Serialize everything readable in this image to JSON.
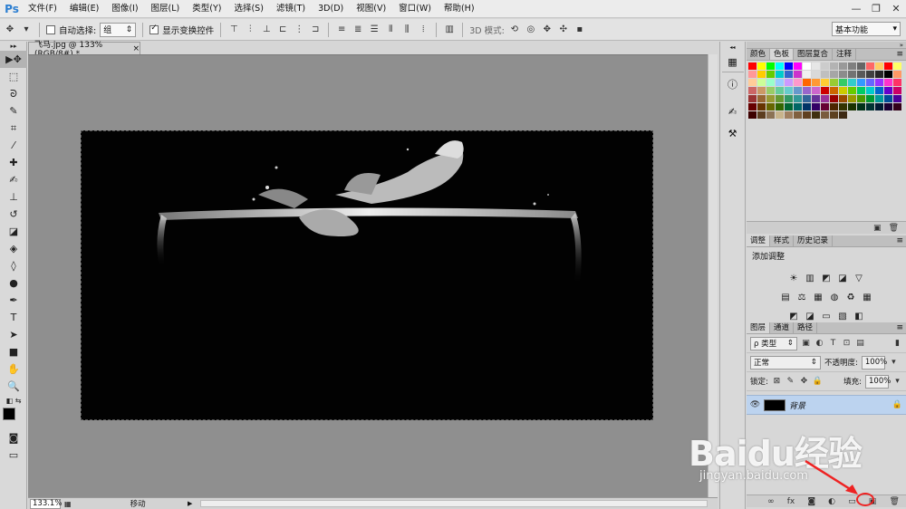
{
  "app": {
    "logo": "Ps"
  },
  "menu": [
    "文件(F)",
    "编辑(E)",
    "图像(I)",
    "图层(L)",
    "类型(Y)",
    "选择(S)",
    "滤镜(T)",
    "3D(D)",
    "视图(V)",
    "窗口(W)",
    "帮助(H)"
  ],
  "window_controls": {
    "minimize": "—",
    "restore": "❐",
    "close": "✕"
  },
  "options": {
    "auto_select_label": "自动选择:",
    "auto_select_value": "组",
    "show_transform_label": "显示变换控件",
    "mode_3d_label": "3D 模式:",
    "workspace": "基本功能"
  },
  "document": {
    "tab_title": "飞马.jpg @ 133%(RGB/8#) *",
    "close": "×"
  },
  "status": {
    "zoom": "133.1%",
    "info": "移动"
  },
  "swatches": {
    "tabs": [
      "颜色",
      "色板",
      "图层复合",
      "注释"
    ],
    "colors": [
      "#ff0000",
      "#ffff00",
      "#00ff00",
      "#00ffff",
      "#0000ff",
      "#ff00ff",
      "#ffffff",
      "#e6e6e6",
      "#cccccc",
      "#b3b3b3",
      "#999999",
      "#808080",
      "#666666",
      "#ff6666",
      "#ffcc66",
      "#ff0000",
      "#ffff66",
      "#ff9999",
      "#ffcc00",
      "#66cc00",
      "#00cccc",
      "#3366cc",
      "#cc33cc",
      "#f0f0f0",
      "#d9d9d9",
      "#bfbfbf",
      "#a6a6a6",
      "#8c8c8c",
      "#737373",
      "#595959",
      "#404040",
      "#262626",
      "#000000",
      "#ff9966",
      "#ffcc99",
      "#ccff99",
      "#99ffcc",
      "#99ccff",
      "#cc99ff",
      "#ff99cc",
      "#ff6600",
      "#ff9933",
      "#ffcc33",
      "#99cc33",
      "#33cc66",
      "#33cccc",
      "#3399ff",
      "#6666ff",
      "#9933ff",
      "#ff33cc",
      "#ff3366",
      "#cc6666",
      "#cc9966",
      "#99cc66",
      "#66cc99",
      "#66cccc",
      "#6699cc",
      "#9966cc",
      "#cc66cc",
      "#cc0000",
      "#cc6600",
      "#cccc00",
      "#66cc00",
      "#00cc66",
      "#00cccc",
      "#0066cc",
      "#6600cc",
      "#cc0066",
      "#993333",
      "#996633",
      "#999933",
      "#669933",
      "#339966",
      "#339999",
      "#336699",
      "#663399",
      "#993399",
      "#990000",
      "#994c00",
      "#999900",
      "#4c9900",
      "#009933",
      "#009999",
      "#004c99",
      "#4c0099",
      "#660000",
      "#663300",
      "#666600",
      "#336600",
      "#006633",
      "#006666",
      "#003366",
      "#330066",
      "#660033",
      "#4d2600",
      "#333300",
      "#1a3300",
      "#003319",
      "#003333",
      "#001a33",
      "#1a0033",
      "#33001a",
      "#3d0000",
      "#5c3d1f",
      "#8c7355",
      "#c8b48c",
      "#a08060",
      "#806040",
      "#604020",
      "#403010",
      "#7a5c3d",
      "#5c4020",
      "#3d2a14"
    ]
  },
  "adjustments": {
    "tabs": [
      "调整",
      "样式",
      "历史记录"
    ],
    "heading": "添加调整",
    "row1": [
      "☀",
      "▥",
      "◩",
      "◪",
      "▽"
    ],
    "row2": [
      "▤",
      "⚖",
      "▦",
      "◍",
      "♻",
      "▦"
    ],
    "row3": [
      "◩",
      "◪",
      "▭",
      "▧",
      "◧"
    ]
  },
  "layers": {
    "tabs": [
      "图层",
      "通道",
      "路径"
    ],
    "filter_label": "ρ 类型",
    "blend_mode": "正常",
    "opacity_label": "不透明度:",
    "opacity_value": "100%",
    "lock_label": "锁定:",
    "fill_label": "填充:",
    "fill_value": "100%",
    "layer_name": "背景",
    "footer_icons": [
      "∞",
      "fx",
      "◙",
      "◐",
      "▭",
      "▣",
      "🗑"
    ]
  },
  "watermark": {
    "main": "Baidu经验",
    "sub": "jingyan.baidu.com"
  },
  "accent": {
    "highlight_red": "#e22222",
    "layer_selected": "#bcd3ef"
  }
}
